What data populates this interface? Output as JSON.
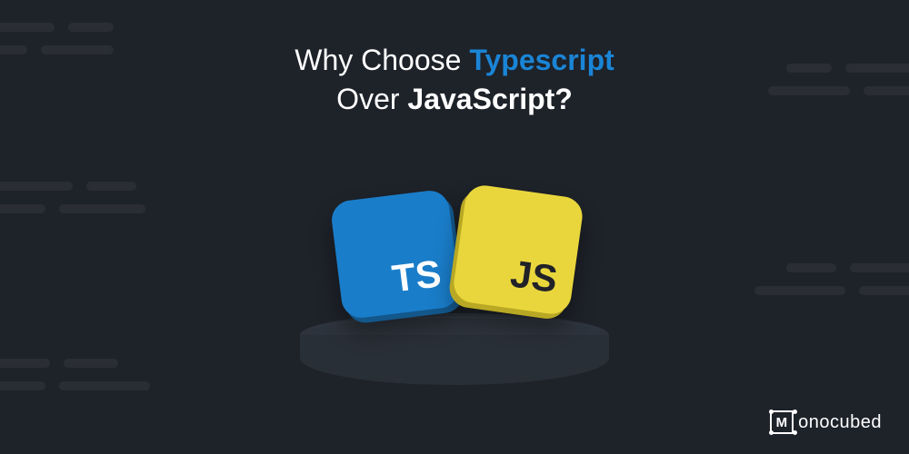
{
  "headline": {
    "part1": "Why Choose ",
    "highlight": "Typescript",
    "part2": "Over ",
    "bold": "JavaScript?"
  },
  "tiles": {
    "ts_label": "TS",
    "js_label": "JS"
  },
  "brand": {
    "mark_letter": "M",
    "text": "onocubed"
  },
  "colors": {
    "background": "#1e2229",
    "ts_tile": "#1a7dc9",
    "js_tile": "#e9d63c",
    "accent_blue": "#1a85d6"
  }
}
